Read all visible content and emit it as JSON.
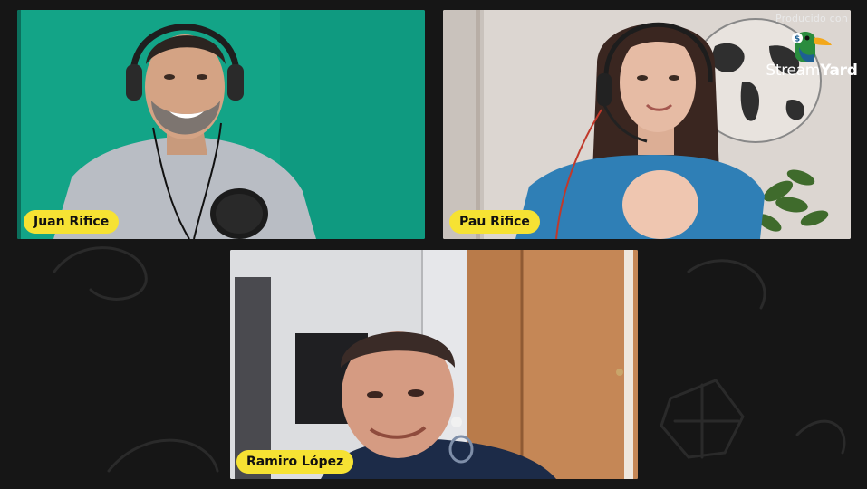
{
  "branding": {
    "produced_with": "Producido con",
    "logo_name_light": "Stream",
    "logo_name_bold": "Yard",
    "logo_icon": "duck-icon"
  },
  "participants": [
    {
      "name": "Juan Rifice"
    },
    {
      "name": "Pau Rifice"
    },
    {
      "name": "Ramiro López"
    }
  ],
  "colors": {
    "background": "#161616",
    "name_tag": "#f6e233",
    "juan_backdrop": "#13a487"
  }
}
